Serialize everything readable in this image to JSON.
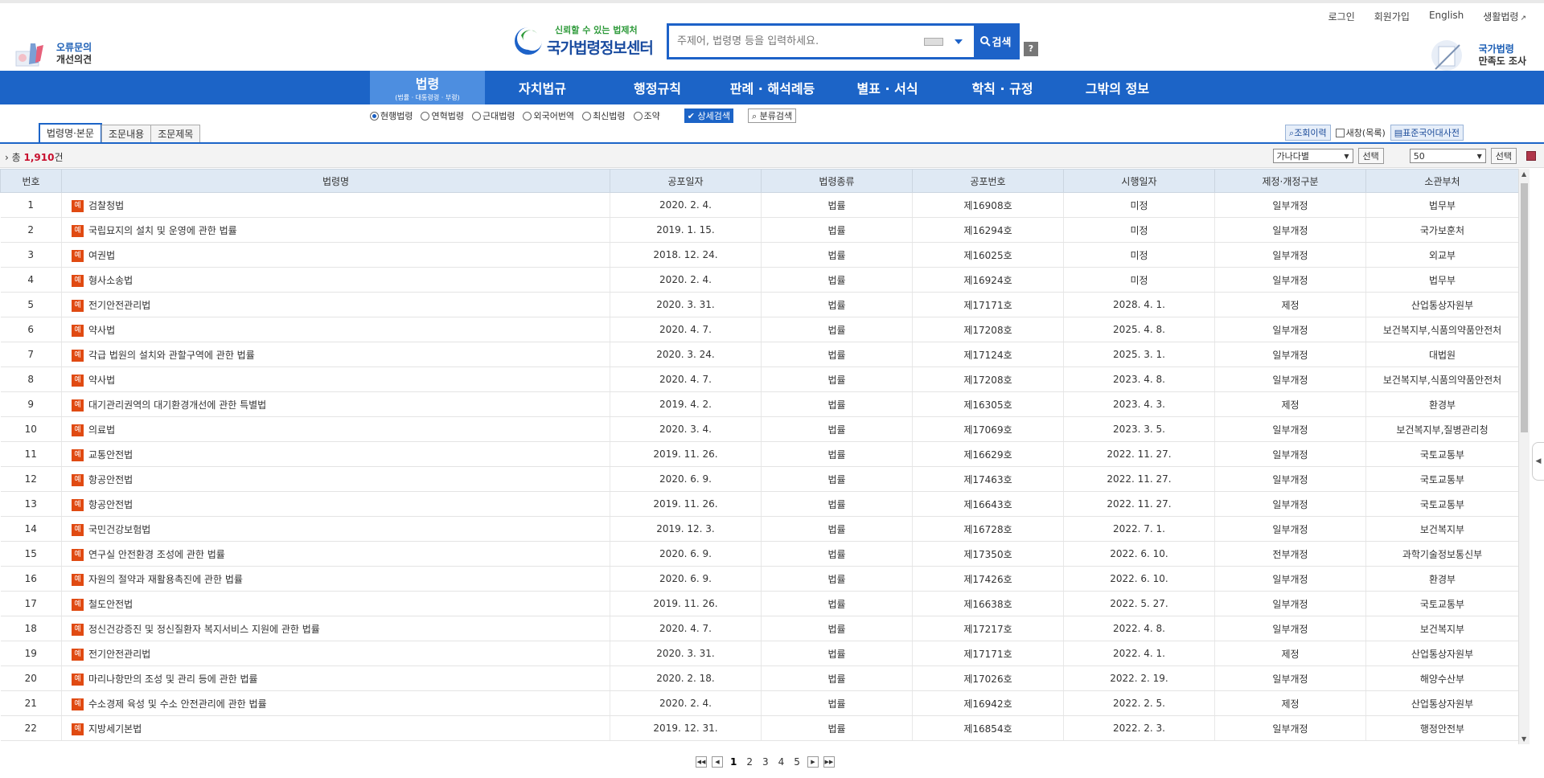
{
  "header": {
    "top_links": [
      "로그인",
      "회원가입",
      "English",
      "생활법령"
    ],
    "feedback": {
      "line1": "오류문의",
      "line2": "개선의견"
    },
    "logo": {
      "slogan": "신뢰할 수 있는 법제처",
      "name": "국가법령정보센터"
    },
    "search": {
      "placeholder": "주제어, 법령명 등을 입력하세요.",
      "button": "검색"
    },
    "help": "?",
    "survey": {
      "line1": "국가법령",
      "line2": "만족도 조사"
    }
  },
  "nav": {
    "items": [
      "법령",
      "자치법규",
      "행정규칙",
      "판례 · 해석례등",
      "별표 · 서식",
      "학칙 · 규정",
      "그밖의 정보"
    ],
    "active_sub": "(법률 · 대통령령 · 부령)"
  },
  "options": {
    "radios": [
      "현행법령",
      "연혁법령",
      "근대법령",
      "외국어번역",
      "최신법령",
      "조약"
    ],
    "selected": "현행법령",
    "detail_search": "상세검색",
    "class_search": "분류검색"
  },
  "tabs": [
    "법령명·본문",
    "조문내용",
    "조문제목"
  ],
  "tools": {
    "history": "조회이력",
    "new_window": "새창(목록)",
    "dictionary": "표준국어대사전"
  },
  "countbar": {
    "prefix": "총",
    "count": "1,910",
    "suffix": "건",
    "sort": "가나다별",
    "select": "선택",
    "per_page": "50",
    "select2": "선택"
  },
  "table": {
    "headers": [
      "번호",
      "법령명",
      "공포일자",
      "법령종류",
      "공포번호",
      "시행일자",
      "제정·개정구분",
      "소관부처"
    ],
    "badge": "예",
    "rows": [
      [
        "1",
        "검찰청법",
        "2020. 2. 4.",
        "법률",
        "제16908호",
        "미정",
        "일부개정",
        "법무부"
      ],
      [
        "2",
        "국립묘지의 설치 및 운영에 관한 법률",
        "2019. 1. 15.",
        "법률",
        "제16294호",
        "미정",
        "일부개정",
        "국가보훈처"
      ],
      [
        "3",
        "여권법",
        "2018. 12. 24.",
        "법률",
        "제16025호",
        "미정",
        "일부개정",
        "외교부"
      ],
      [
        "4",
        "형사소송법",
        "2020. 2. 4.",
        "법률",
        "제16924호",
        "미정",
        "일부개정",
        "법무부"
      ],
      [
        "5",
        "전기안전관리법",
        "2020. 3. 31.",
        "법률",
        "제17171호",
        "2028. 4. 1.",
        "제정",
        "산업통상자원부"
      ],
      [
        "6",
        "약사법",
        "2020. 4. 7.",
        "법률",
        "제17208호",
        "2025. 4. 8.",
        "일부개정",
        "보건복지부,식품의약품안전처"
      ],
      [
        "7",
        "각급 법원의 설치와 관할구역에 관한 법률",
        "2020. 3. 24.",
        "법률",
        "제17124호",
        "2025. 3. 1.",
        "일부개정",
        "대법원"
      ],
      [
        "8",
        "약사법",
        "2020. 4. 7.",
        "법률",
        "제17208호",
        "2023. 4. 8.",
        "일부개정",
        "보건복지부,식품의약품안전처"
      ],
      [
        "9",
        "대기관리권역의 대기환경개선에 관한 특별법",
        "2019. 4. 2.",
        "법률",
        "제16305호",
        "2023. 4. 3.",
        "제정",
        "환경부"
      ],
      [
        "10",
        "의료법",
        "2020. 3. 4.",
        "법률",
        "제17069호",
        "2023. 3. 5.",
        "일부개정",
        "보건복지부,질병관리청"
      ],
      [
        "11",
        "교통안전법",
        "2019. 11. 26.",
        "법률",
        "제16629호",
        "2022. 11. 27.",
        "일부개정",
        "국토교통부"
      ],
      [
        "12",
        "항공안전법",
        "2020. 6. 9.",
        "법률",
        "제17463호",
        "2022. 11. 27.",
        "일부개정",
        "국토교통부"
      ],
      [
        "13",
        "항공안전법",
        "2019. 11. 26.",
        "법률",
        "제16643호",
        "2022. 11. 27.",
        "일부개정",
        "국토교통부"
      ],
      [
        "14",
        "국민건강보험법",
        "2019. 12. 3.",
        "법률",
        "제16728호",
        "2022. 7. 1.",
        "일부개정",
        "보건복지부"
      ],
      [
        "15",
        "연구실 안전환경 조성에 관한 법률",
        "2020. 6. 9.",
        "법률",
        "제17350호",
        "2022. 6. 10.",
        "전부개정",
        "과학기술정보통신부"
      ],
      [
        "16",
        "자원의 절약과 재활용촉진에 관한 법률",
        "2020. 6. 9.",
        "법률",
        "제17426호",
        "2022. 6. 10.",
        "일부개정",
        "환경부"
      ],
      [
        "17",
        "철도안전법",
        "2019. 11. 26.",
        "법률",
        "제16638호",
        "2022. 5. 27.",
        "일부개정",
        "국토교통부"
      ],
      [
        "18",
        "정신건강증진 및 정신질환자 복지서비스 지원에 관한 법률",
        "2020. 4. 7.",
        "법률",
        "제17217호",
        "2022. 4. 8.",
        "일부개정",
        "보건복지부"
      ],
      [
        "19",
        "전기안전관리법",
        "2020. 3. 31.",
        "법률",
        "제17171호",
        "2022. 4. 1.",
        "제정",
        "산업통상자원부"
      ],
      [
        "20",
        "마리나항만의 조성 및 관리 등에 관한 법률",
        "2020. 2. 18.",
        "법률",
        "제17026호",
        "2022. 2. 19.",
        "일부개정",
        "해양수산부"
      ],
      [
        "21",
        "수소경제 육성 및 수소 안전관리에 관한 법률",
        "2020. 2. 4.",
        "법률",
        "제16942호",
        "2022. 2. 5.",
        "제정",
        "산업통상자원부"
      ],
      [
        "22",
        "지방세기본법",
        "2019. 12. 31.",
        "법률",
        "제16854호",
        "2022. 2. 3.",
        "일부개정",
        "행정안전부"
      ]
    ]
  },
  "pager": {
    "pages": [
      "1",
      "2",
      "3",
      "4",
      "5"
    ],
    "current": "1"
  }
}
